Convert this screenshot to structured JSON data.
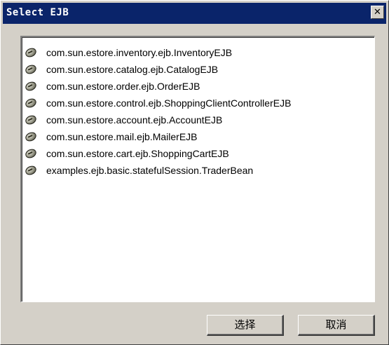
{
  "window": {
    "title": "Select EJB",
    "close_glyph": "✕"
  },
  "list": {
    "items": [
      {
        "label": "com.sun.estore.inventory.ejb.InventoryEJB",
        "icon": "bean-icon"
      },
      {
        "label": "com.sun.estore.catalog.ejb.CatalogEJB",
        "icon": "bean-icon"
      },
      {
        "label": "com.sun.estore.order.ejb.OrderEJB",
        "icon": "bean-icon"
      },
      {
        "label": "com.sun.estore.control.ejb.ShoppingClientControllerEJB",
        "icon": "bean-icon"
      },
      {
        "label": "com.sun.estore.account.ejb.AccountEJB",
        "icon": "bean-icon"
      },
      {
        "label": "com.sun.estore.mail.ejb.MailerEJB",
        "icon": "bean-icon"
      },
      {
        "label": "com.sun.estore.cart.ejb.ShoppingCartEJB",
        "icon": "bean-icon"
      },
      {
        "label": "examples.ejb.basic.statefulSession.TraderBean",
        "icon": "bean-icon"
      }
    ]
  },
  "buttons": {
    "select_label": "选择",
    "cancel_label": "取消"
  },
  "colors": {
    "titlebar": "#0a246a",
    "dialog": "#d4d0c8",
    "list_bg": "#ffffff"
  }
}
